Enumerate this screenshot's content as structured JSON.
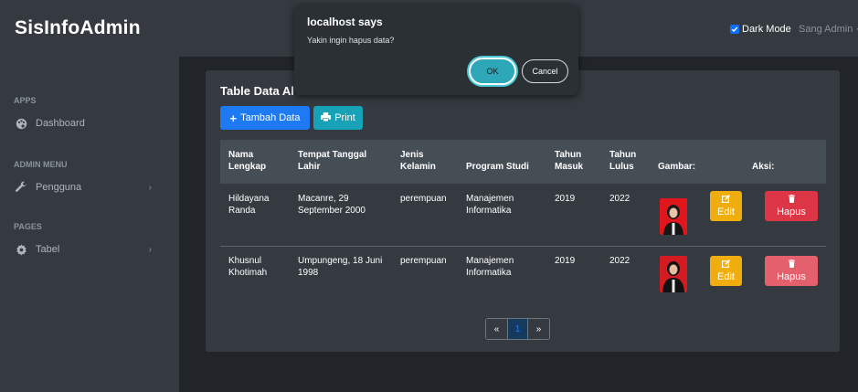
{
  "brand": "SisInfoAdmin",
  "sidebar": {
    "sections": [
      {
        "heading": "APPS",
        "items": [
          {
            "label": "Dashboard",
            "icon": "palette-icon"
          }
        ]
      },
      {
        "heading": "ADMIN MENU",
        "items": [
          {
            "label": "Pengguna",
            "icon": "wrench-icon",
            "chevron": "›"
          }
        ]
      },
      {
        "heading": "PAGES",
        "items": [
          {
            "label": "Tabel",
            "icon": "gear-icon",
            "chevron": "›"
          }
        ]
      }
    ]
  },
  "topbar": {
    "dark_mode_label": "Dark Mode",
    "dark_mode_checked": true,
    "user_label": "Sang Admin"
  },
  "card": {
    "title": "Table Data Al",
    "add_button": "Tambah Data",
    "print_button": "Print"
  },
  "table": {
    "headers": [
      "Nama Lengkap",
      "Tempat Tanggal Lahir",
      "Jenis Kelamin",
      "Program Studi",
      "Tahun Masuk",
      "Tahun Lulus",
      "Gambar:",
      "Aksi:"
    ],
    "rows": [
      {
        "nama": "Hildayana Randa",
        "ttl": "Macanre, 29 September 2000",
        "jk": "perempuan",
        "prodi": "Manajemen Informatika",
        "masuk": "2019",
        "lulus": "2022",
        "edit": "Edit",
        "hapus": "Hapus"
      },
      {
        "nama": "Khusnul Khotimah",
        "ttl": "Umpungeng, 18 Juni 1998",
        "jk": "perempuan",
        "prodi": "Manajemen Informatika",
        "masuk": "2019",
        "lulus": "2022",
        "edit": "Edit",
        "hapus": "Hapus"
      }
    ]
  },
  "pagination": {
    "first": "«",
    "current": "1",
    "last": "»"
  },
  "dialog": {
    "title": "localhost says",
    "message": "Yakin ingin hapus data?",
    "ok": "OK",
    "cancel": "Cancel"
  },
  "colors": {
    "accent": "#1d7af3",
    "info": "#17a2b8",
    "warning": "#f0ad0e",
    "danger": "#dc3545",
    "dialog_ok": "#2ea8b8"
  }
}
